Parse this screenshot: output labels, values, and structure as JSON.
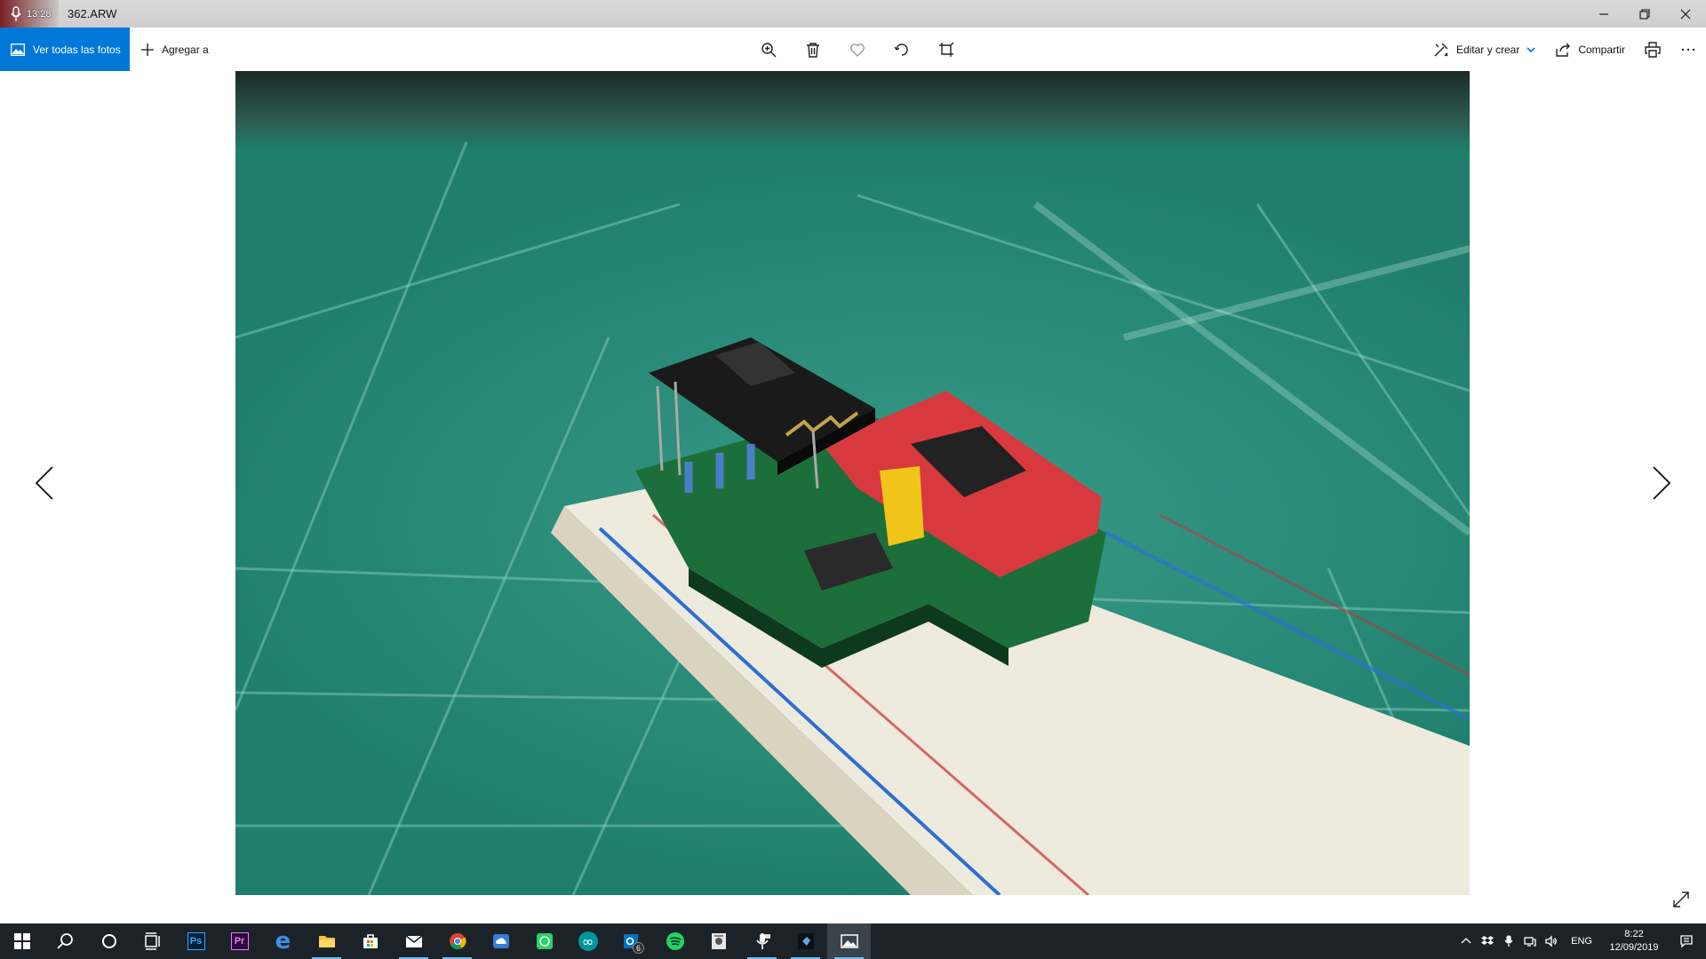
{
  "titlebar": {
    "recording_time": "13:28",
    "file_name": "362.ARW",
    "controls": [
      "minimize-icon",
      "restore-icon",
      "close-icon"
    ]
  },
  "toolbar": {
    "view_all_label": "Ver todas las fotos",
    "add_to_label": "Agregar a",
    "center_tools": [
      "zoom-in-icon",
      "delete-icon",
      "favorite-icon",
      "rotate-icon",
      "crop-icon"
    ],
    "edit_create_label": "Editar y crear",
    "share_label": "Compartir",
    "accent_color": "#0078d7"
  },
  "taskbar": {
    "apps": [
      {
        "name": "start-icon"
      },
      {
        "name": "search-icon"
      },
      {
        "name": "cortana-icon"
      },
      {
        "name": "task-view-icon"
      },
      {
        "name": "photoshop-icon",
        "label": "Ps"
      },
      {
        "name": "premiere-icon",
        "label": "Pr"
      },
      {
        "name": "edge-icon",
        "label": "e"
      },
      {
        "name": "file-explorer-icon"
      },
      {
        "name": "store-icon"
      },
      {
        "name": "mail-icon"
      },
      {
        "name": "chrome-icon"
      },
      {
        "name": "cloud-app-icon"
      },
      {
        "name": "whatsapp-icon"
      },
      {
        "name": "arduino-icon",
        "label": "∞"
      },
      {
        "name": "outlook-icon",
        "badge": "6"
      },
      {
        "name": "spotify-icon"
      },
      {
        "name": "document-app-icon"
      },
      {
        "name": "voice-recorder-icon"
      },
      {
        "name": "dev-app-icon"
      },
      {
        "name": "photos-icon"
      }
    ],
    "tray": {
      "language": "ENG",
      "time": "8:22",
      "date": "12/09/2019"
    }
  }
}
